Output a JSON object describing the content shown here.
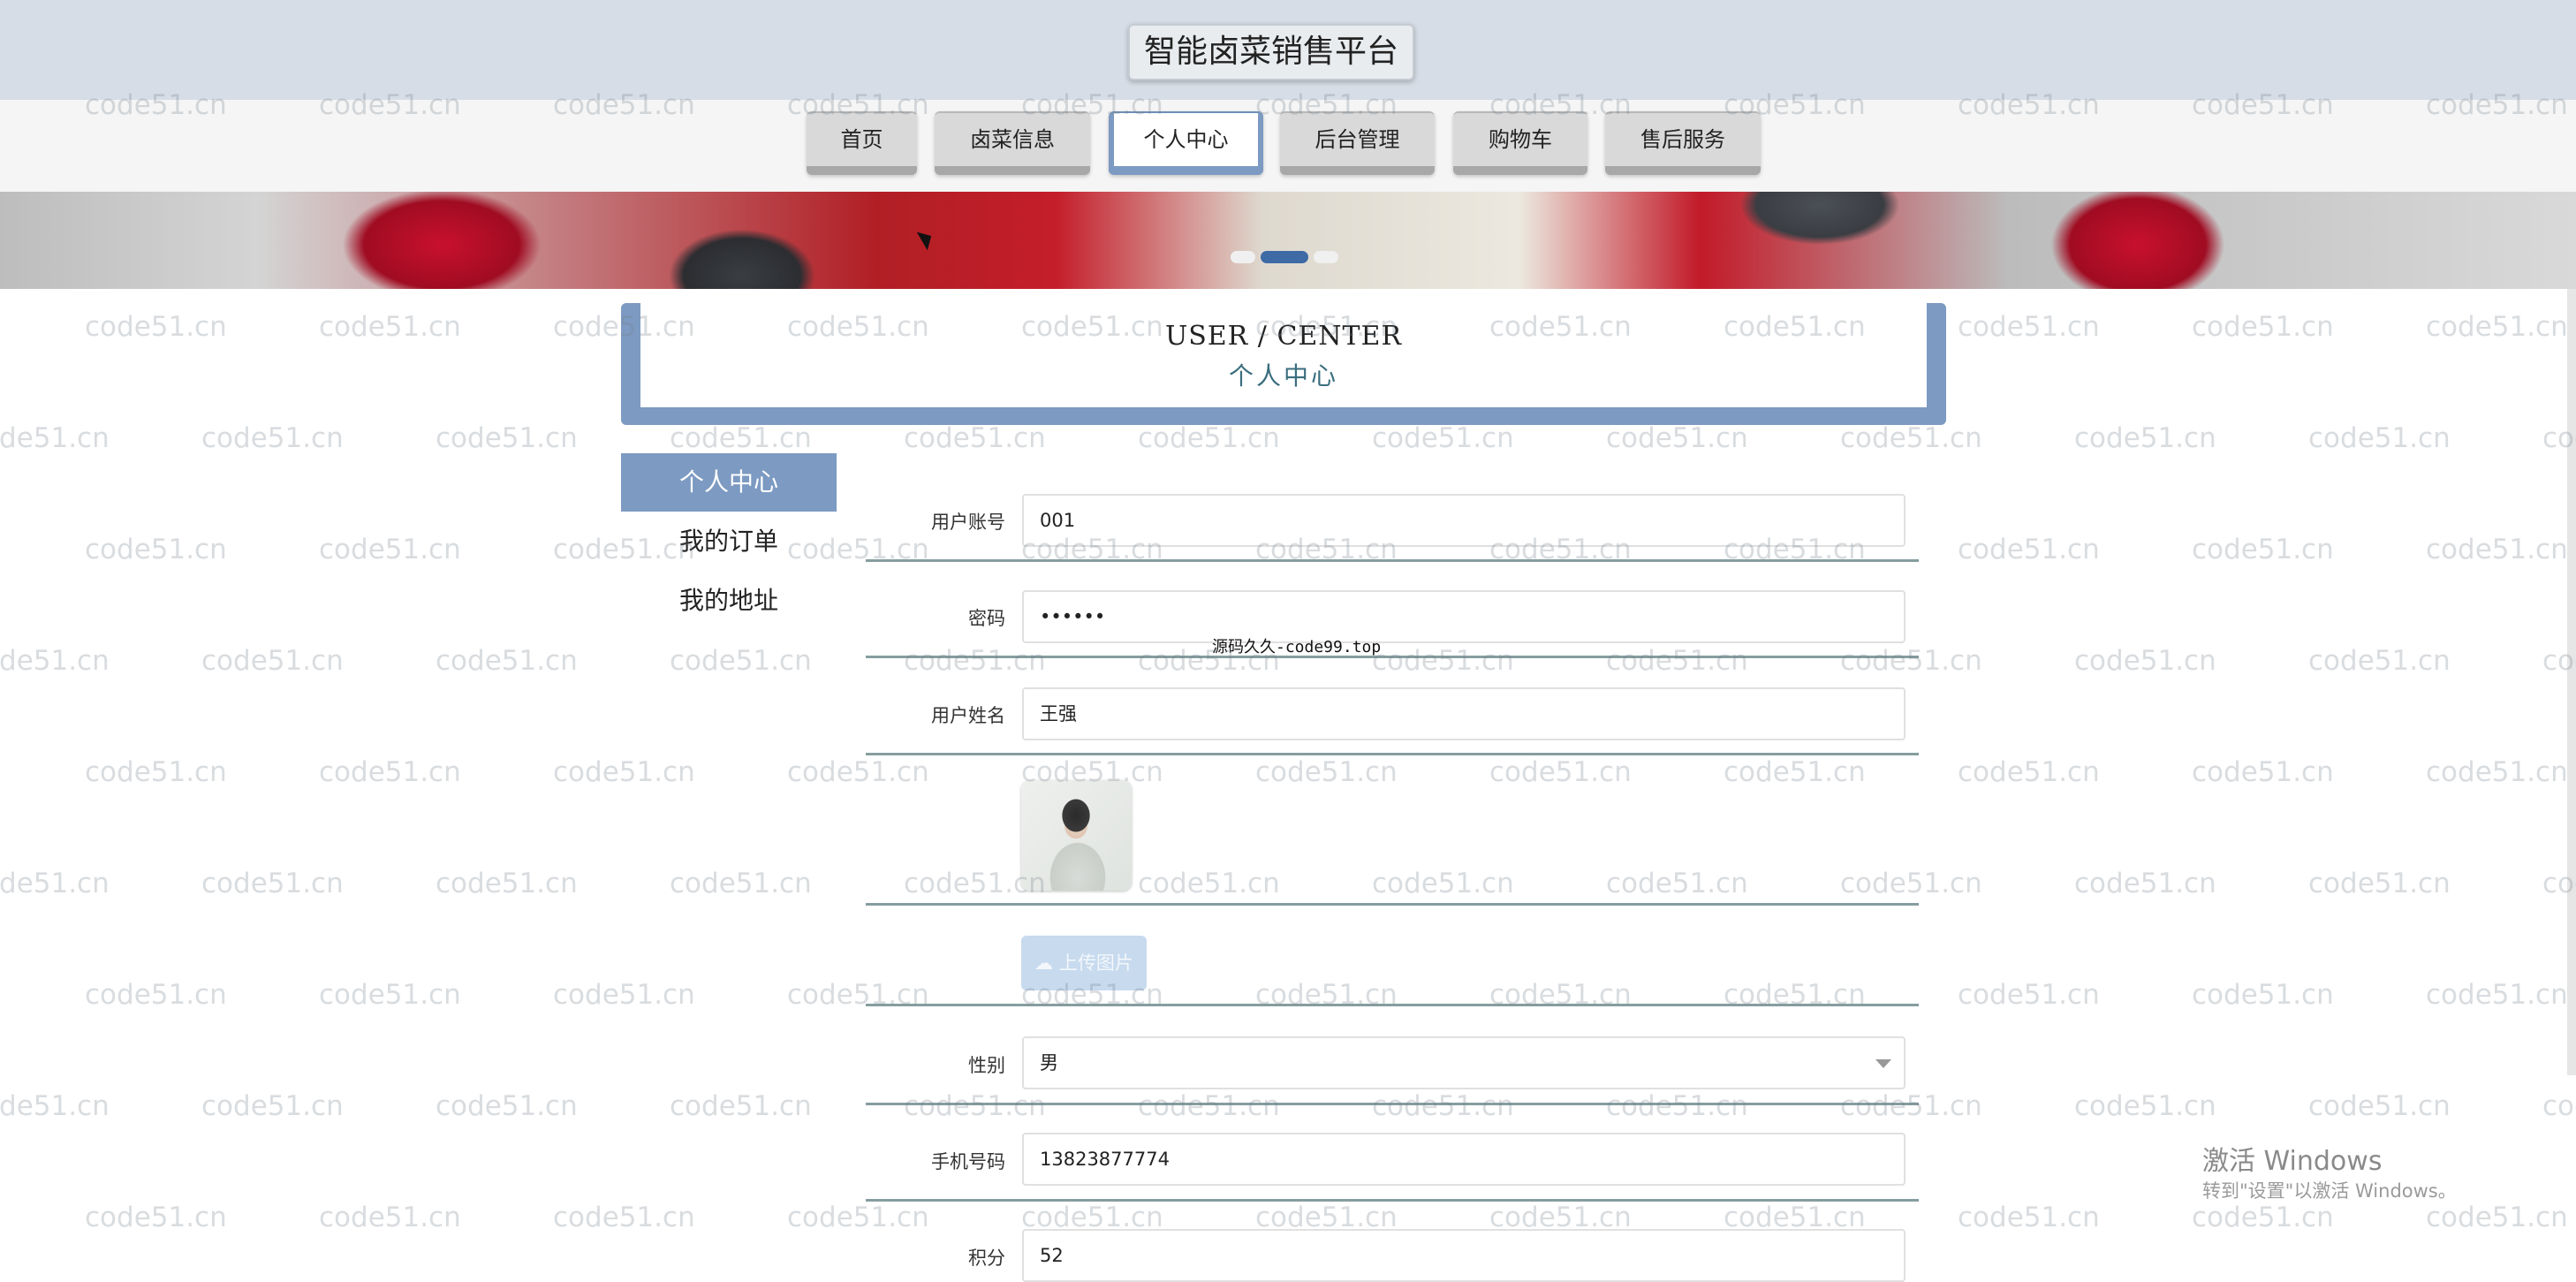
{
  "header": {
    "title": "智能卤菜销售平台"
  },
  "nav": {
    "items": [
      "首页",
      "卤菜信息",
      "个人中心",
      "后台管理",
      "购物车",
      "售后服务"
    ],
    "active_index": 2
  },
  "banner": {
    "dots": 3,
    "active_dot": 1
  },
  "user_center": {
    "title_en": "USER / CENTER",
    "title_cn": "个人中心"
  },
  "side_menu": {
    "items": [
      "个人中心",
      "我的订单",
      "我的地址"
    ],
    "active_index": 0
  },
  "form": {
    "account_label": "用户账号",
    "account_value": "001",
    "password_label": "密码",
    "password_value": "••••••",
    "name_label": "用户姓名",
    "name_value": "王强",
    "upload_label": "上传图片",
    "gender_label": "性别",
    "gender_value": "男",
    "phone_label": "手机号码",
    "phone_value": "13823877774",
    "points_label": "积分",
    "points_value": "52"
  },
  "popup_text": "源码久久-code99.top",
  "watermark": "code51.cn",
  "os_notice": {
    "title": "激活 Windows",
    "subtitle": "转到\"设置\"以激活 Windows。"
  },
  "colors": {
    "accent": "#7c9ac2",
    "header_bg": "#d6dde6",
    "upload_btn": "#c7daee"
  }
}
